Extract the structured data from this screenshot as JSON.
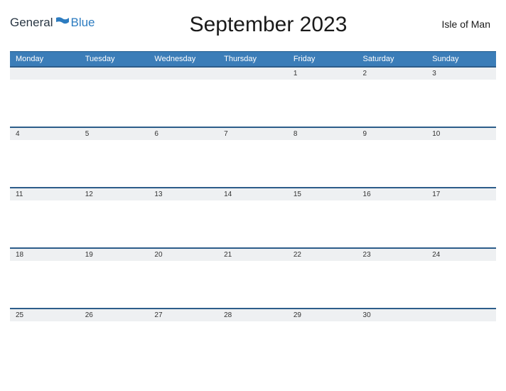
{
  "logo": {
    "word1": "General",
    "word2": "Blue"
  },
  "title": "September 2023",
  "region": "Isle of Man",
  "headers": [
    "Monday",
    "Tuesday",
    "Wednesday",
    "Thursday",
    "Friday",
    "Saturday",
    "Sunday"
  ],
  "weeks": [
    [
      "",
      "",
      "",
      "",
      "1",
      "2",
      "3"
    ],
    [
      "4",
      "5",
      "6",
      "7",
      "8",
      "9",
      "10"
    ],
    [
      "11",
      "12",
      "13",
      "14",
      "15",
      "16",
      "17"
    ],
    [
      "18",
      "19",
      "20",
      "21",
      "22",
      "23",
      "24"
    ],
    [
      "25",
      "26",
      "27",
      "28",
      "29",
      "30",
      ""
    ]
  ]
}
